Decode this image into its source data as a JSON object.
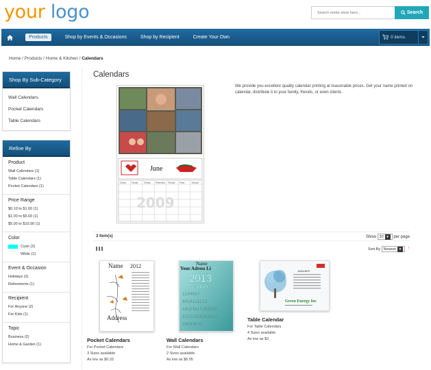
{
  "header": {
    "logo_your": "your",
    "logo_logo": "logo",
    "search_placeholder": "Search entire store here...",
    "search_label": "Search"
  },
  "nav": {
    "items": [
      "Products",
      "Shop by Events & Occasions",
      "Shop by Recipient",
      "Create Your Own"
    ],
    "cart_label": "0 items"
  },
  "breadcrumb": {
    "path": "Home / Products / Home & Kitchen / ",
    "current": "Calendars"
  },
  "sidebar": {
    "subcategory_title": "Shop By Sub-Category",
    "subcategories": [
      "Wall Calendars",
      "Pocket Calendars",
      "Table Calendars"
    ],
    "refine_title": "Refine By",
    "groups": [
      {
        "title": "Product",
        "options": [
          "Wall Calendars (1)",
          "Table Calendars (1)",
          "Pocket Calendars (1)"
        ]
      },
      {
        "title": "Price Range",
        "options": [
          "$0.10 to $1.00 (1)",
          "$1.00 to $5.00 (1)",
          "$5.00 to $10.00 (1)"
        ]
      },
      {
        "title": "Color",
        "options": [
          "Cyan (2)",
          "White (1)"
        ]
      },
      {
        "title": "Event & Occasion",
        "options": [
          "Holidays (2)",
          "Retirements (1)"
        ]
      },
      {
        "title": "Recipient",
        "options": [
          "For Anyone (2)",
          "For Kids (1)"
        ]
      },
      {
        "title": "Topic",
        "options": [
          "Business (2)",
          "Home & Garden (1)"
        ]
      }
    ]
  },
  "main": {
    "title": "Calendars",
    "description": "We provide you excellent quality calendar printing at reasonable prices. Get your name printed on calendar, distribute it to your family, friends, or even clients.",
    "hero": {
      "month": "June",
      "weekdays": [
        "Sunday",
        "Monday",
        "Tuesday",
        "Wednesday",
        "Thursday",
        "Friday",
        "Saturday"
      ]
    },
    "item_count": "3 Item(s)",
    "show_label": "Show",
    "show_value": "20",
    "per_page_label": "per page",
    "sort_label": "Sort By",
    "sort_value": "Newest"
  },
  "products": [
    {
      "name": "Pocket Calendars",
      "line1": "For Pocket Calendars",
      "line2": "3 Sizes available",
      "line3": "As low as $0.33",
      "thumb_title": "Name",
      "thumb_year": "2012",
      "thumb_footer": "Address"
    },
    {
      "name": "Wall Calendars",
      "line1": "For Wall Calendars",
      "line2": "2 Sizes available",
      "line3": "As low as $6.95",
      "thumb_title": "Name",
      "thumb_subtitle": "Your Adress Li",
      "thumb_year": "2013",
      "thumb_month": "October"
    },
    {
      "name": "Table Calendar",
      "line1": "For Table Calendars",
      "line2": "4 Sizes available",
      "line3": "As low as $2",
      "thumb_month": "JANUARY",
      "thumb_company": "Green Energy Inc"
    }
  ],
  "colors": {
    "logo_orange": "#f29400",
    "logo_blue": "#4a90c8",
    "nav_blue": "#1f6aa0",
    "search_teal": "#22a7b8",
    "cyan_swatch": "#00ffff"
  }
}
